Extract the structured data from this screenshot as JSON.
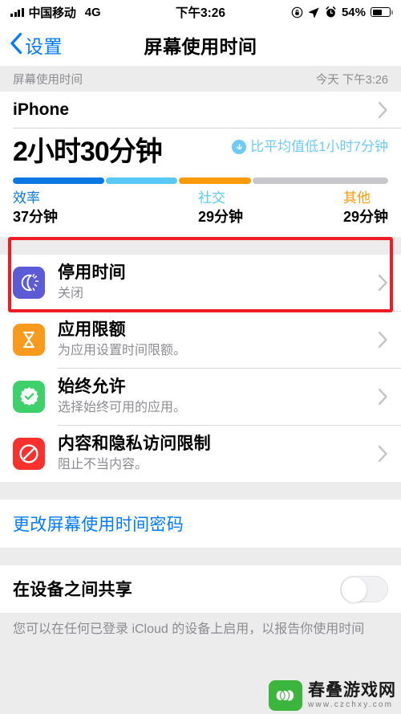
{
  "status_bar": {
    "carrier": "中国移动",
    "network": "4G",
    "time": "下午3:26",
    "battery_percent": "54%",
    "battery_level": 54,
    "icons": [
      "signal-bars-icon",
      "rotation-lock-icon",
      "location-arrow-icon",
      "alarm-clock-icon",
      "battery-icon"
    ]
  },
  "nav": {
    "back_label": "设置",
    "title": "屏幕使用时间"
  },
  "section_header": {
    "label": "屏幕使用时间",
    "timestamp": "今天 下午3:26"
  },
  "device_row": {
    "label": "iPhone"
  },
  "usage": {
    "total": "2小时30分钟",
    "comparison": "比平均值低1小时7分钟",
    "comparison_direction": "down",
    "comparison_color": "#6fcbf3"
  },
  "chart_data": {
    "type": "bar",
    "title": "屏幕使用时间",
    "orientation": "horizontal-stacked",
    "total_label": "2小时30分钟",
    "total_minutes": 150,
    "categories": [
      "效率",
      "社交",
      "其他",
      ""
    ],
    "values": [
      37,
      29,
      29,
      55
    ],
    "value_labels": [
      "37分钟",
      "29分钟",
      "29分钟",
      ""
    ],
    "colors": [
      "#0b77e3",
      "#5ac8f5",
      "#fa9c0a",
      "#c7c7cc"
    ],
    "legend": [
      {
        "name": "效率",
        "value": "37分钟",
        "color": "#0b77e3"
      },
      {
        "name": "社交",
        "value": "29分钟",
        "color": "#5ac8f5"
      },
      {
        "name": "其他",
        "value": "29分钟",
        "color": "#fa9c0a"
      }
    ],
    "legend_position": "below",
    "grid": false
  },
  "settings": [
    {
      "title": "停用时间",
      "subtitle": "关闭",
      "icon": "downtime-moon-icon",
      "icon_color": "#5b5bd6",
      "highlighted": true
    },
    {
      "title": "应用限额",
      "subtitle": "为应用设置时间限额。",
      "icon": "hourglass-icon",
      "icon_color": "#f79a1e"
    },
    {
      "title": "始终允许",
      "subtitle": "选择始终可用的应用。",
      "icon": "checkmark-badge-icon",
      "icon_color": "#3ed06a"
    },
    {
      "title": "内容和隐私访问限制",
      "subtitle": "阻止不当内容。",
      "icon": "prohibition-icon",
      "icon_color": "#f8312f"
    }
  ],
  "passcode_link": {
    "label": "更改屏幕使用时间密码"
  },
  "share": {
    "label": "在设备之间共享",
    "toggle_on": false,
    "footnote": "您可以在任何已登录 iCloud 的设备上启用，以报告你使用时间"
  },
  "watermark": {
    "name": "春叠游戏网",
    "url": "www.czchxy.com"
  },
  "annotation": {
    "color": "#ee1c25",
    "target": "停用时间"
  }
}
